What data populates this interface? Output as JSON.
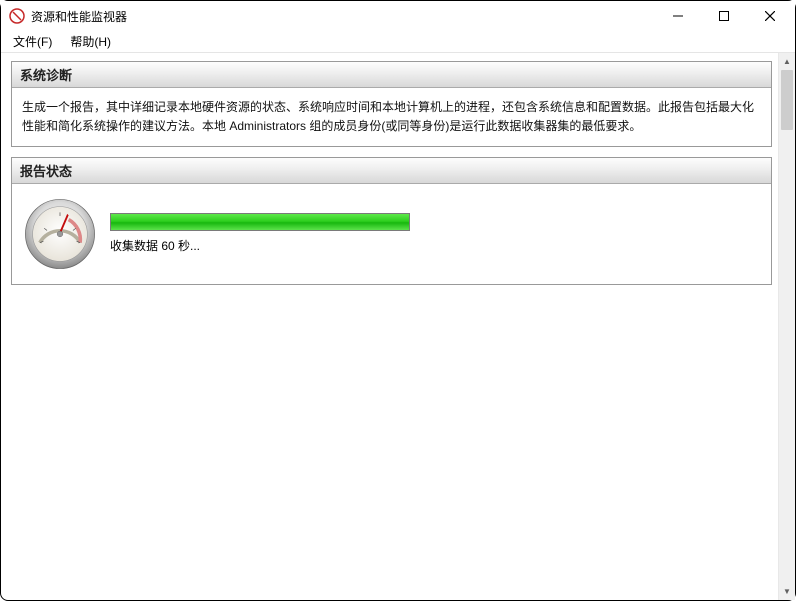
{
  "window": {
    "title": "资源和性能监视器"
  },
  "menu": {
    "file": "文件(F)",
    "help": "帮助(H)"
  },
  "panels": {
    "diag": {
      "header": "系统诊断",
      "body": "生成一个报告，其中详细记录本地硬件资源的状态、系统响应时间和本地计算机上的进程，还包含系统信息和配置数据。此报告包括最大化性能和简化系统操作的建议方法。本地 Administrators 组的成员身份(或同等身份)是运行此数据收集器集的最低要求。"
    },
    "status": {
      "header": "报告状态",
      "progress_text": "收集数据 60 秒..."
    }
  }
}
